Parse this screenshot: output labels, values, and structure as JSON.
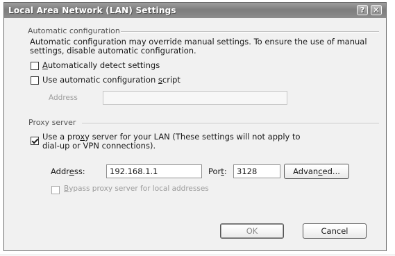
{
  "window": {
    "title": "Local Area Network (LAN) Settings",
    "help_icon": "question-mark-icon",
    "close_icon": "close-icon"
  },
  "automatic": {
    "group_title": "Automatic configuration",
    "description": "Automatic configuration may override manual settings.  To ensure the use of manual settings, disable automatic configuration.",
    "detect_label_key": "A",
    "detect_label_rest": "utomatically detect settings",
    "detect_checked": false,
    "script_label_pre": "Use automatic configuration ",
    "script_label_key": "s",
    "script_label_post": "cript",
    "script_checked": false,
    "address_label": "Address",
    "address_value": ""
  },
  "proxy": {
    "group_title": "Proxy server",
    "use_proxy_pre": "Use a pro",
    "use_proxy_key": "x",
    "use_proxy_post": "y server for your LAN (These settings will not apply to",
    "use_proxy_line2": "dial-up or VPN connections).",
    "use_proxy_checked": true,
    "address_label_pre": "Addr",
    "address_label_key": "e",
    "address_label_post": "ss:",
    "address_value": "192.168.1.1",
    "port_label_pre": "Por",
    "port_label_key": "t",
    "port_label_post": ":",
    "port_value": "3128",
    "advanced_pre": "Advan",
    "advanced_key": "c",
    "advanced_post": "ed...",
    "bypass_key": "B",
    "bypass_rest": "ypass proxy server for local addresses",
    "bypass_checked": false
  },
  "buttons": {
    "ok": "OK",
    "cancel": "Cancel"
  }
}
